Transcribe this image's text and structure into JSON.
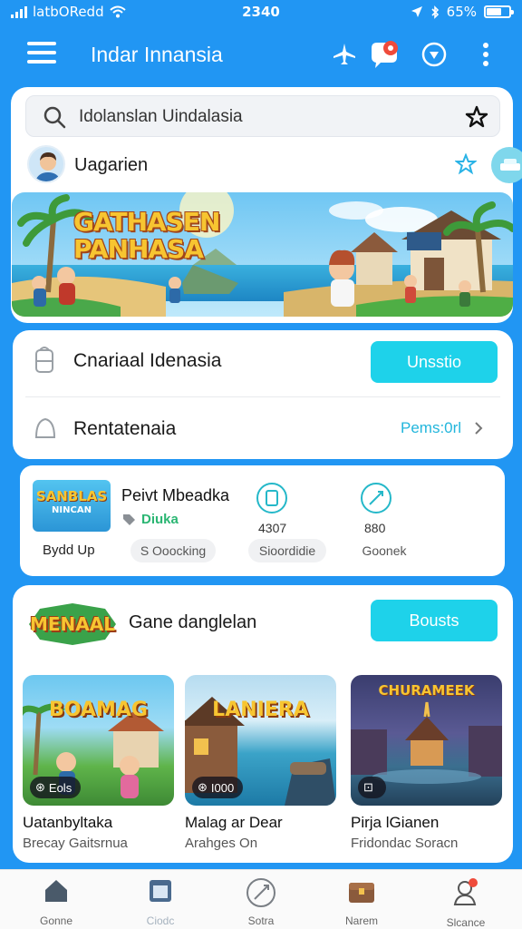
{
  "status": {
    "carrier": "latbORedd",
    "time": "2340",
    "battery": "65%",
    "battery_level": 0.65
  },
  "appbar": {
    "title": "Indar Innansia"
  },
  "search": {
    "placeholder": "Idolanslan Uindalasia"
  },
  "user": {
    "name": "Uagarien"
  },
  "banner": {
    "headline_1": "GATHASEN",
    "headline_2": "PANHASA"
  },
  "row1": {
    "label": "Cnariaal Idenasia",
    "button": "Unsstio"
  },
  "row2": {
    "label": "Rentatenaia",
    "link": "Pems:0rl"
  },
  "stats": {
    "thumb_line1": "SANBLAS",
    "thumb_line2": "NINCAN",
    "title": "Peivt Mbeadka",
    "tag": "Diuka",
    "caption": "Bydd Up",
    "value_a": "4307",
    "value_b": "880",
    "chip_1": "S Ooocking",
    "chip_2": "Sioordidie",
    "chip_3": "Goonek"
  },
  "section": {
    "logo": "MENAAL",
    "title": "Gane danglelan",
    "button": "Bousts"
  },
  "games": [
    {
      "art": "BOAMAG",
      "badge": "Eols",
      "title": "Uatanbyltaka",
      "subtitle": "Brecay Gaitsrnua"
    },
    {
      "art": "LANIERA",
      "badge": "I000",
      "title": "Malag ar Dear",
      "subtitle": "Arahges On"
    },
    {
      "art": "CHURAMEEK",
      "badge": "",
      "title": "Pirja lGianen",
      "subtitle": "Fridondac Soracn"
    }
  ],
  "nav": [
    {
      "label": "Gonne",
      "icon": "home-icon"
    },
    {
      "label": "Ciodc",
      "icon": "calendar-icon"
    },
    {
      "label": "Sotra",
      "icon": "sword-icon"
    },
    {
      "label": "Narem",
      "icon": "chest-icon"
    },
    {
      "label": "Slcance",
      "icon": "profile-icon"
    }
  ]
}
